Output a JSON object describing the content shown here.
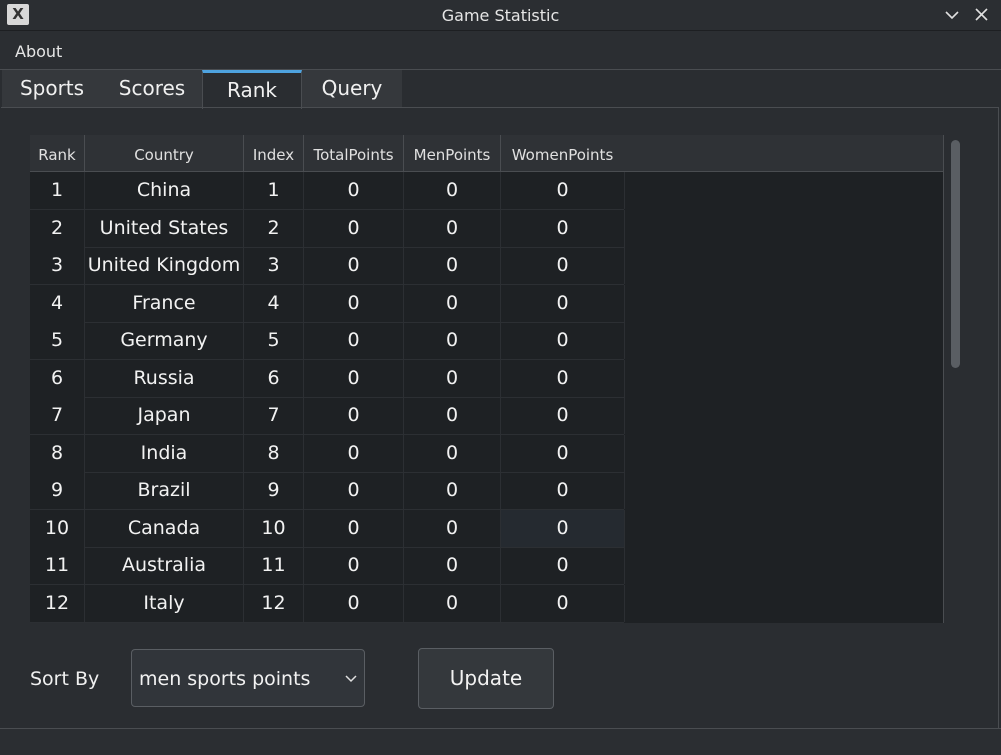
{
  "window": {
    "title": "Game Statistic"
  },
  "menu": {
    "about": "About"
  },
  "tabs": [
    {
      "label": "Sports",
      "active": false
    },
    {
      "label": "Scores",
      "active": false
    },
    {
      "label": "Rank",
      "active": true
    },
    {
      "label": "Query",
      "active": false
    }
  ],
  "table": {
    "headers": [
      "Rank",
      "Country",
      "Index",
      "TotalPoints",
      "MenPoints",
      "WomenPoints"
    ],
    "rows": [
      [
        "1",
        "China",
        "1",
        "0",
        "0",
        "0"
      ],
      [
        "2",
        "United States",
        "2",
        "0",
        "0",
        "0"
      ],
      [
        "3",
        "United Kingdom",
        "3",
        "0",
        "0",
        "0"
      ],
      [
        "4",
        "France",
        "4",
        "0",
        "0",
        "0"
      ],
      [
        "5",
        "Germany",
        "5",
        "0",
        "0",
        "0"
      ],
      [
        "6",
        "Russia",
        "6",
        "0",
        "0",
        "0"
      ],
      [
        "7",
        "Japan",
        "7",
        "0",
        "0",
        "0"
      ],
      [
        "8",
        "India",
        "8",
        "0",
        "0",
        "0"
      ],
      [
        "9",
        "Brazil",
        "9",
        "0",
        "0",
        "0"
      ],
      [
        "10",
        "Canada",
        "10",
        "0",
        "0",
        "0"
      ],
      [
        "11",
        "Australia",
        "11",
        "0",
        "0",
        "0"
      ],
      [
        "12",
        "Italy",
        "12",
        "0",
        "0",
        "0"
      ]
    ]
  },
  "controls": {
    "sort_label": "Sort By",
    "sort_value": "men sports points",
    "update_label": "Update"
  },
  "colors": {
    "accent": "#4ea3e0",
    "background": "#2a2d31",
    "table_bg": "#1e2124"
  }
}
